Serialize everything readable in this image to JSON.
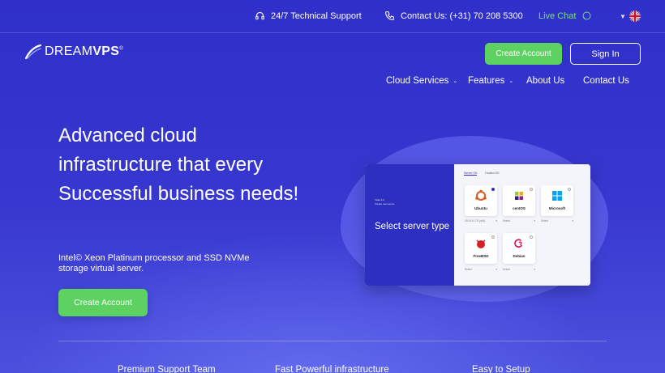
{
  "topbar": {
    "support": "24/7 Technical Support",
    "contact": "Contact Us: (+31) 70 208 5300",
    "live_chat": "Live Chat"
  },
  "header": {
    "logo_light": "DREAM",
    "logo_bold": "VPS",
    "logo_mark": "®",
    "create_account": "Create Account",
    "sign_in": "Sign In"
  },
  "nav": {
    "cloud_services": "Cloud Services",
    "features": "Features",
    "about_us": "About Us",
    "contact_us": "Contact Us"
  },
  "hero": {
    "title": "Advanced cloud infrastructure that every Successful business needs!",
    "subtitle": "Intel© Xeon Platinum processor and SSD NVMe storage virtual server.",
    "cta": "Create Account"
  },
  "illustration": {
    "mini_title": "Vitae 2.0",
    "mini_sub": "Create new server",
    "select_label": "Select server type",
    "tabs": [
      "Server OS",
      "Hosted OS"
    ],
    "os": [
      {
        "name": "Ubuntu",
        "selector": "18.04.6 LTS (x64)"
      },
      {
        "name": "centOS",
        "selector": "Select"
      },
      {
        "name": "Microsoft",
        "selector": "Select"
      },
      {
        "name": "FreeBSD",
        "selector": "Select"
      },
      {
        "name": "Debian",
        "selector": "Select"
      }
    ]
  },
  "features": {
    "f1": "Premium Support Team",
    "f2": "Fast Powerful infrastructure",
    "f3": "Easy to Setup"
  },
  "colors": {
    "background": "#3434cc",
    "accent_green": "#5dd162",
    "live_chat": "#7de07a"
  }
}
